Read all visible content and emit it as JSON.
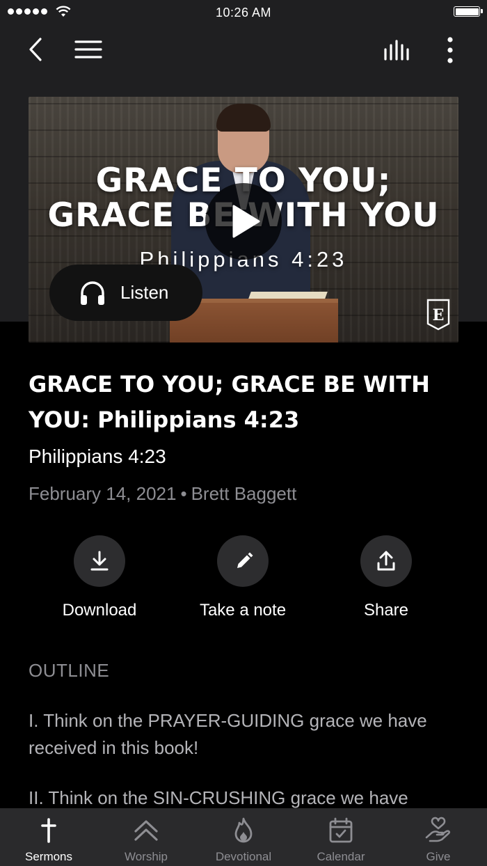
{
  "status_bar": {
    "time": "10:26 AM"
  },
  "nav": {
    "back_icon": "chevron-left-icon",
    "menu_icon": "hamburger-icon",
    "audio_icon": "audio-bars-icon",
    "more_icon": "more-vertical-icon"
  },
  "hero": {
    "title_line1": "GRACE TO YOU;",
    "title_line2": "GRACE BE WITH YOU",
    "subtitle": "Philippians 4:23",
    "listen_label": "Listen",
    "logo_letter": "E"
  },
  "sermon": {
    "title": "GRACE TO YOU; GRACE BE WITH YOU: Philippians 4:23",
    "scripture": "Philippians 4:23",
    "date": "February 14, 2021",
    "separator": "•",
    "speaker": "Brett Baggett"
  },
  "actions": [
    {
      "label": "Download",
      "icon": "download-icon"
    },
    {
      "label": "Take a note",
      "icon": "pencil-icon"
    },
    {
      "label": "Share",
      "icon": "share-icon"
    }
  ],
  "outline": {
    "heading": "OUTLINE",
    "points": [
      "I. Think on the PRAYER-GUIDING grace we have received in this book!",
      "II. Think on the SIN-CRUSHING grace we have"
    ]
  },
  "tabs": [
    {
      "label": "Sermons",
      "icon": "cross-icon",
      "active": true
    },
    {
      "label": "Worship",
      "icon": "double-chevron-up-icon",
      "active": false
    },
    {
      "label": "Devotional",
      "icon": "flame-icon",
      "active": false
    },
    {
      "label": "Calendar",
      "icon": "calendar-icon",
      "active": false
    },
    {
      "label": "Give",
      "icon": "heart-hand-icon",
      "active": false
    }
  ],
  "colors": {
    "header_bg": "#1f1f21",
    "page_bg": "#000000",
    "muted_text": "#8e8e93",
    "tab_bar": "#2a2a2c"
  }
}
